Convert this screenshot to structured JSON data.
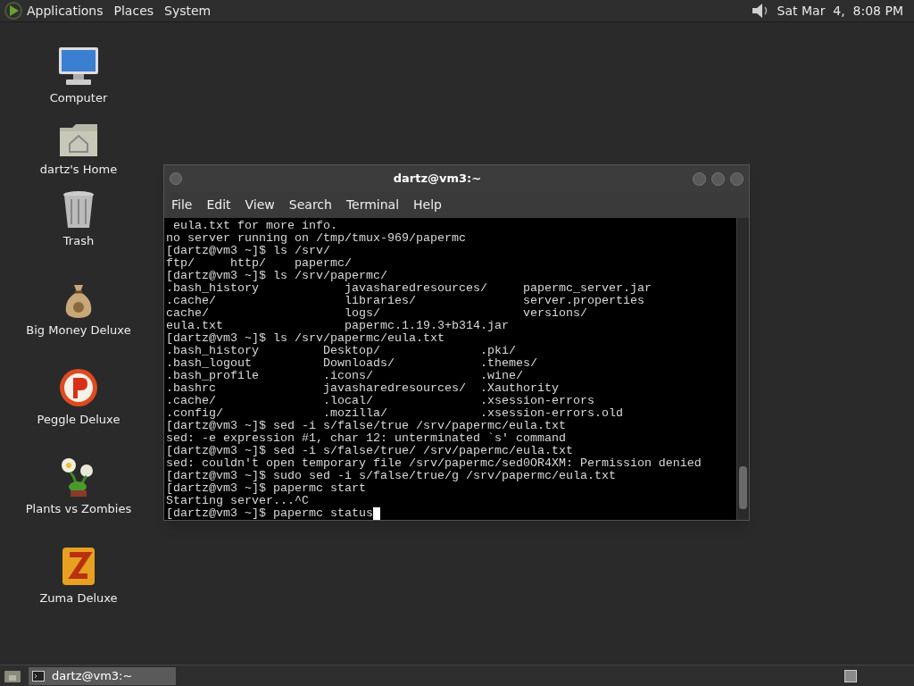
{
  "top_panel": {
    "menus": [
      "Applications",
      "Places",
      "System"
    ],
    "clock": "Sat Mar  4,  8:08 PM"
  },
  "desktop_icons": [
    {
      "kind": "computer",
      "label": "Computer"
    },
    {
      "kind": "home",
      "label": "dartz's Home"
    },
    {
      "kind": "trash",
      "label": "Trash"
    },
    {
      "kind": "moneybag",
      "label": "Big Money Deluxe"
    },
    {
      "kind": "ball",
      "label": "Peggle Deluxe"
    },
    {
      "kind": "plant",
      "label": "Plants vs Zombies"
    },
    {
      "kind": "zuma",
      "label": "Zuma Deluxe"
    }
  ],
  "terminal": {
    "title": "dartz@vm3:~",
    "menu": [
      "File",
      "Edit",
      "View",
      "Search",
      "Terminal",
      "Help"
    ],
    "lines": [
      " eula.txt for more info.",
      "no server running on /tmp/tmux-969/papermc",
      "[dartz@vm3 ~]$ ls /srv/",
      "ftp/     http/    papermc/",
      "[dartz@vm3 ~]$ ls /srv/papermc/",
      ".bash_history            javasharedresources/     papermc_server.jar",
      ".cache/                  libraries/               server.properties",
      "cache/                   logs/                    versions/",
      "eula.txt                 papermc.1.19.3+b314.jar",
      "[dartz@vm3 ~]$ ls /srv/papermc/eula.txt",
      ".bash_history         Desktop/              .pki/",
      ".bash_logout          Downloads/            .themes/",
      ".bash_profile         .icons/               .wine/",
      ".bashrc               javasharedresources/  .Xauthority",
      ".cache/               .local/               .xsession-errors",
      ".config/              .mozilla/             .xsession-errors.old",
      "[dartz@vm3 ~]$ sed -i s/false/true /srv/papermc/eula.txt",
      "sed: -e expression #1, char 12: unterminated `s' command",
      "[dartz@vm3 ~]$ sed -i s/false/true/ /srv/papermc/eula.txt",
      "sed: couldn't open temporary file /srv/papermc/sed0OR4XM: Permission denied",
      "[dartz@vm3 ~]$ sudo sed -i s/false/true/g /srv/papermc/eula.txt",
      "[dartz@vm3 ~]$ papermc start",
      "Starting server...^C",
      "[dartz@vm3 ~]$ papermc status"
    ],
    "cursor": true
  },
  "taskbar": {
    "items": [
      {
        "label": "dartz@vm3:~",
        "selected": true
      }
    ]
  }
}
